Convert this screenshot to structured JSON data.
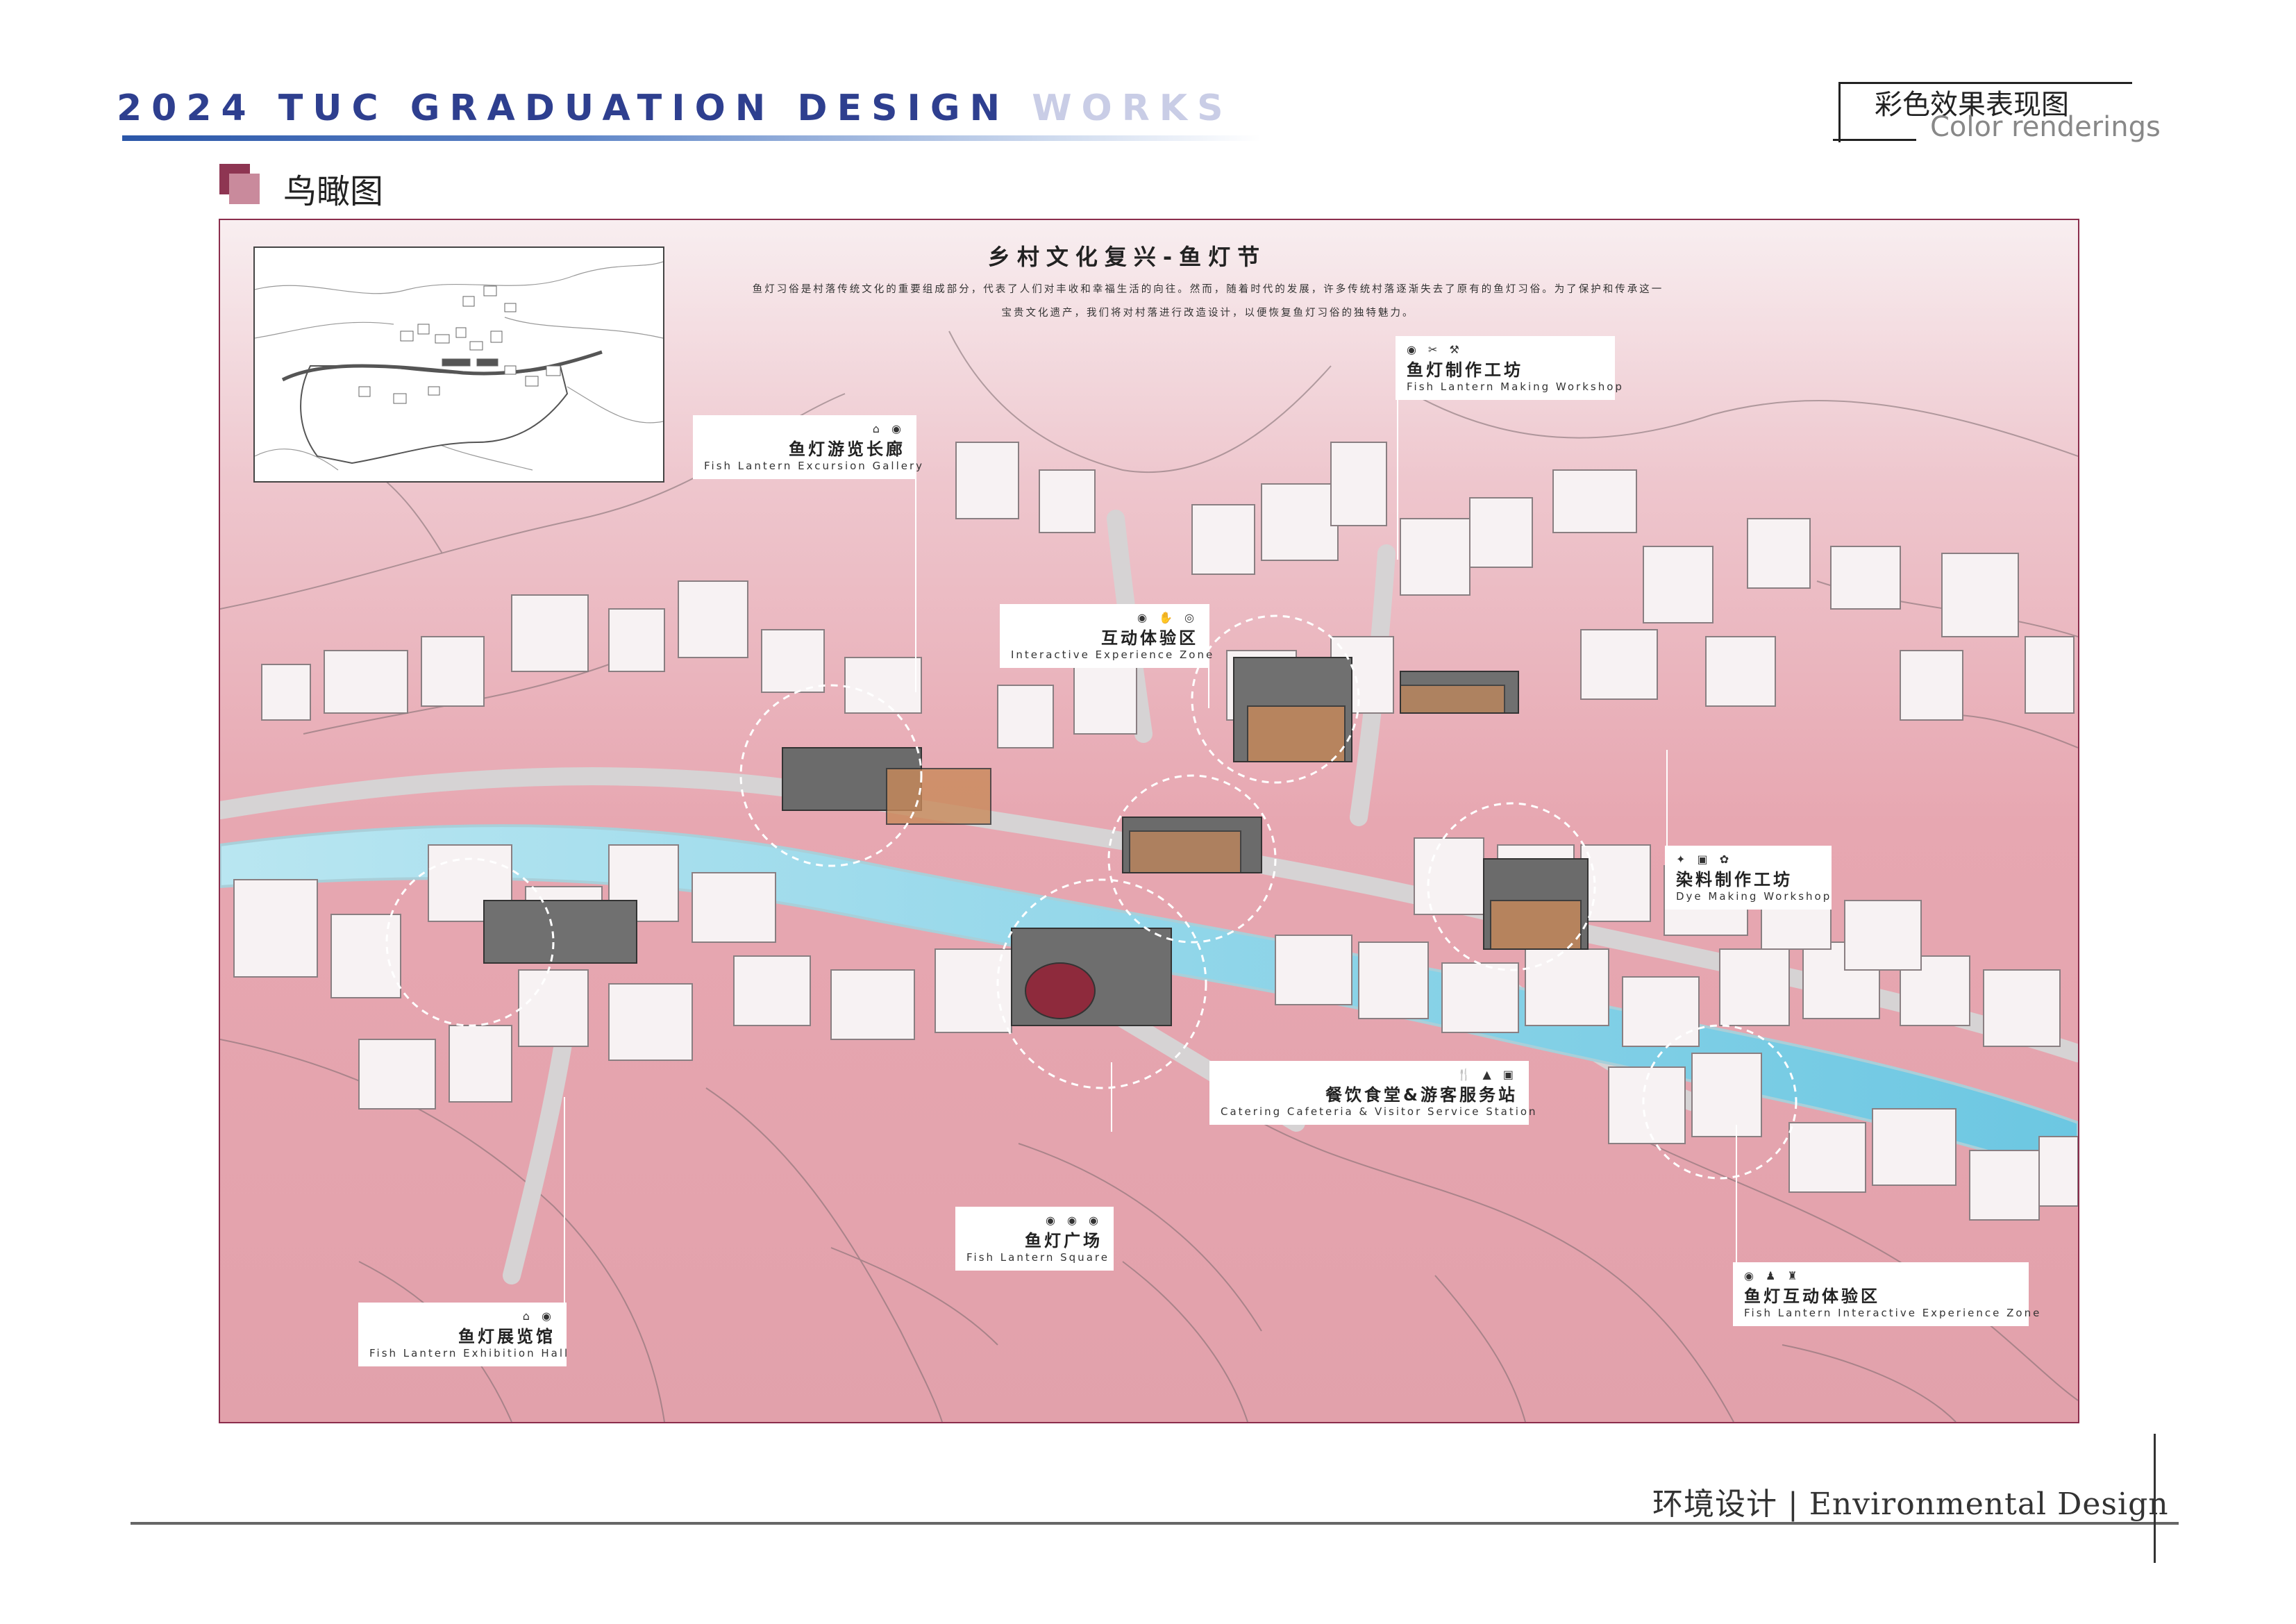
{
  "header": {
    "title_part1": "2024 TUC GRADUATION DESIGN",
    "title_part2": "WORKS",
    "category_cn": "彩色效果表现图",
    "category_en": "Color renderings"
  },
  "section": {
    "title": "鸟瞰图"
  },
  "map": {
    "title": "乡村文化复兴-鱼灯节",
    "intro_line1": "鱼灯习俗是村落传统文化的重要组成部分，代表了人们对丰收和幸福生活的向往。然而，随着时代的发展，许多传统村落逐渐失去了原有的鱼灯习俗。为了保护和传承这一",
    "intro_line2": "宝贵文化遗产，我们将对村落进行改造设计，以便恢复鱼灯习俗的独特魅力。",
    "colors": {
      "land": "#e7a4ae",
      "land_light": "#f6e4e7",
      "river": "#8fd3e6",
      "road": "#d9d9d9",
      "building": "#f7f2f3",
      "roof_dark": "#6b6b6b",
      "accent_wood": "#c98a5a",
      "frame": "#8b2d4c"
    },
    "labels": [
      {
        "id": "gallery",
        "icons": "⌂ ◉",
        "cn": "鱼灯游览长廊",
        "en": "Fish Lantern Excursion Gallery"
      },
      {
        "id": "interactive",
        "icons": "◉ ✋ ◎",
        "cn": "互动体验区",
        "en": "Interactive Experience Zone"
      },
      {
        "id": "workshop",
        "icons": "◉ ✂ ⚒",
        "cn": "鱼灯制作工坊",
        "en": "Fish Lantern Making Workshop"
      },
      {
        "id": "dye",
        "icons": "✦ ▣ ✿",
        "cn": "染料制作工坊",
        "en": "Dye Making Workshop"
      },
      {
        "id": "catering",
        "icons": "🍴 ▲ ▣",
        "cn": "餐饮食堂&游客服务站",
        "en": "Catering Cafeteria & Visitor Service Station"
      },
      {
        "id": "square",
        "icons": "◉ ◉ ◉",
        "cn": "鱼灯广场",
        "en": "Fish Lantern Square"
      },
      {
        "id": "exhibition",
        "icons": "⌂ ◉",
        "cn": "鱼灯展览馆",
        "en": "Fish Lantern Exhibition Hall"
      },
      {
        "id": "lantern_zone",
        "icons": "◉ ♟ ♜",
        "cn": "鱼灯互动体验区",
        "en": "Fish Lantern Interactive Experience Zone"
      }
    ]
  },
  "footer": {
    "text": "环境设计 | Environmental Design"
  }
}
